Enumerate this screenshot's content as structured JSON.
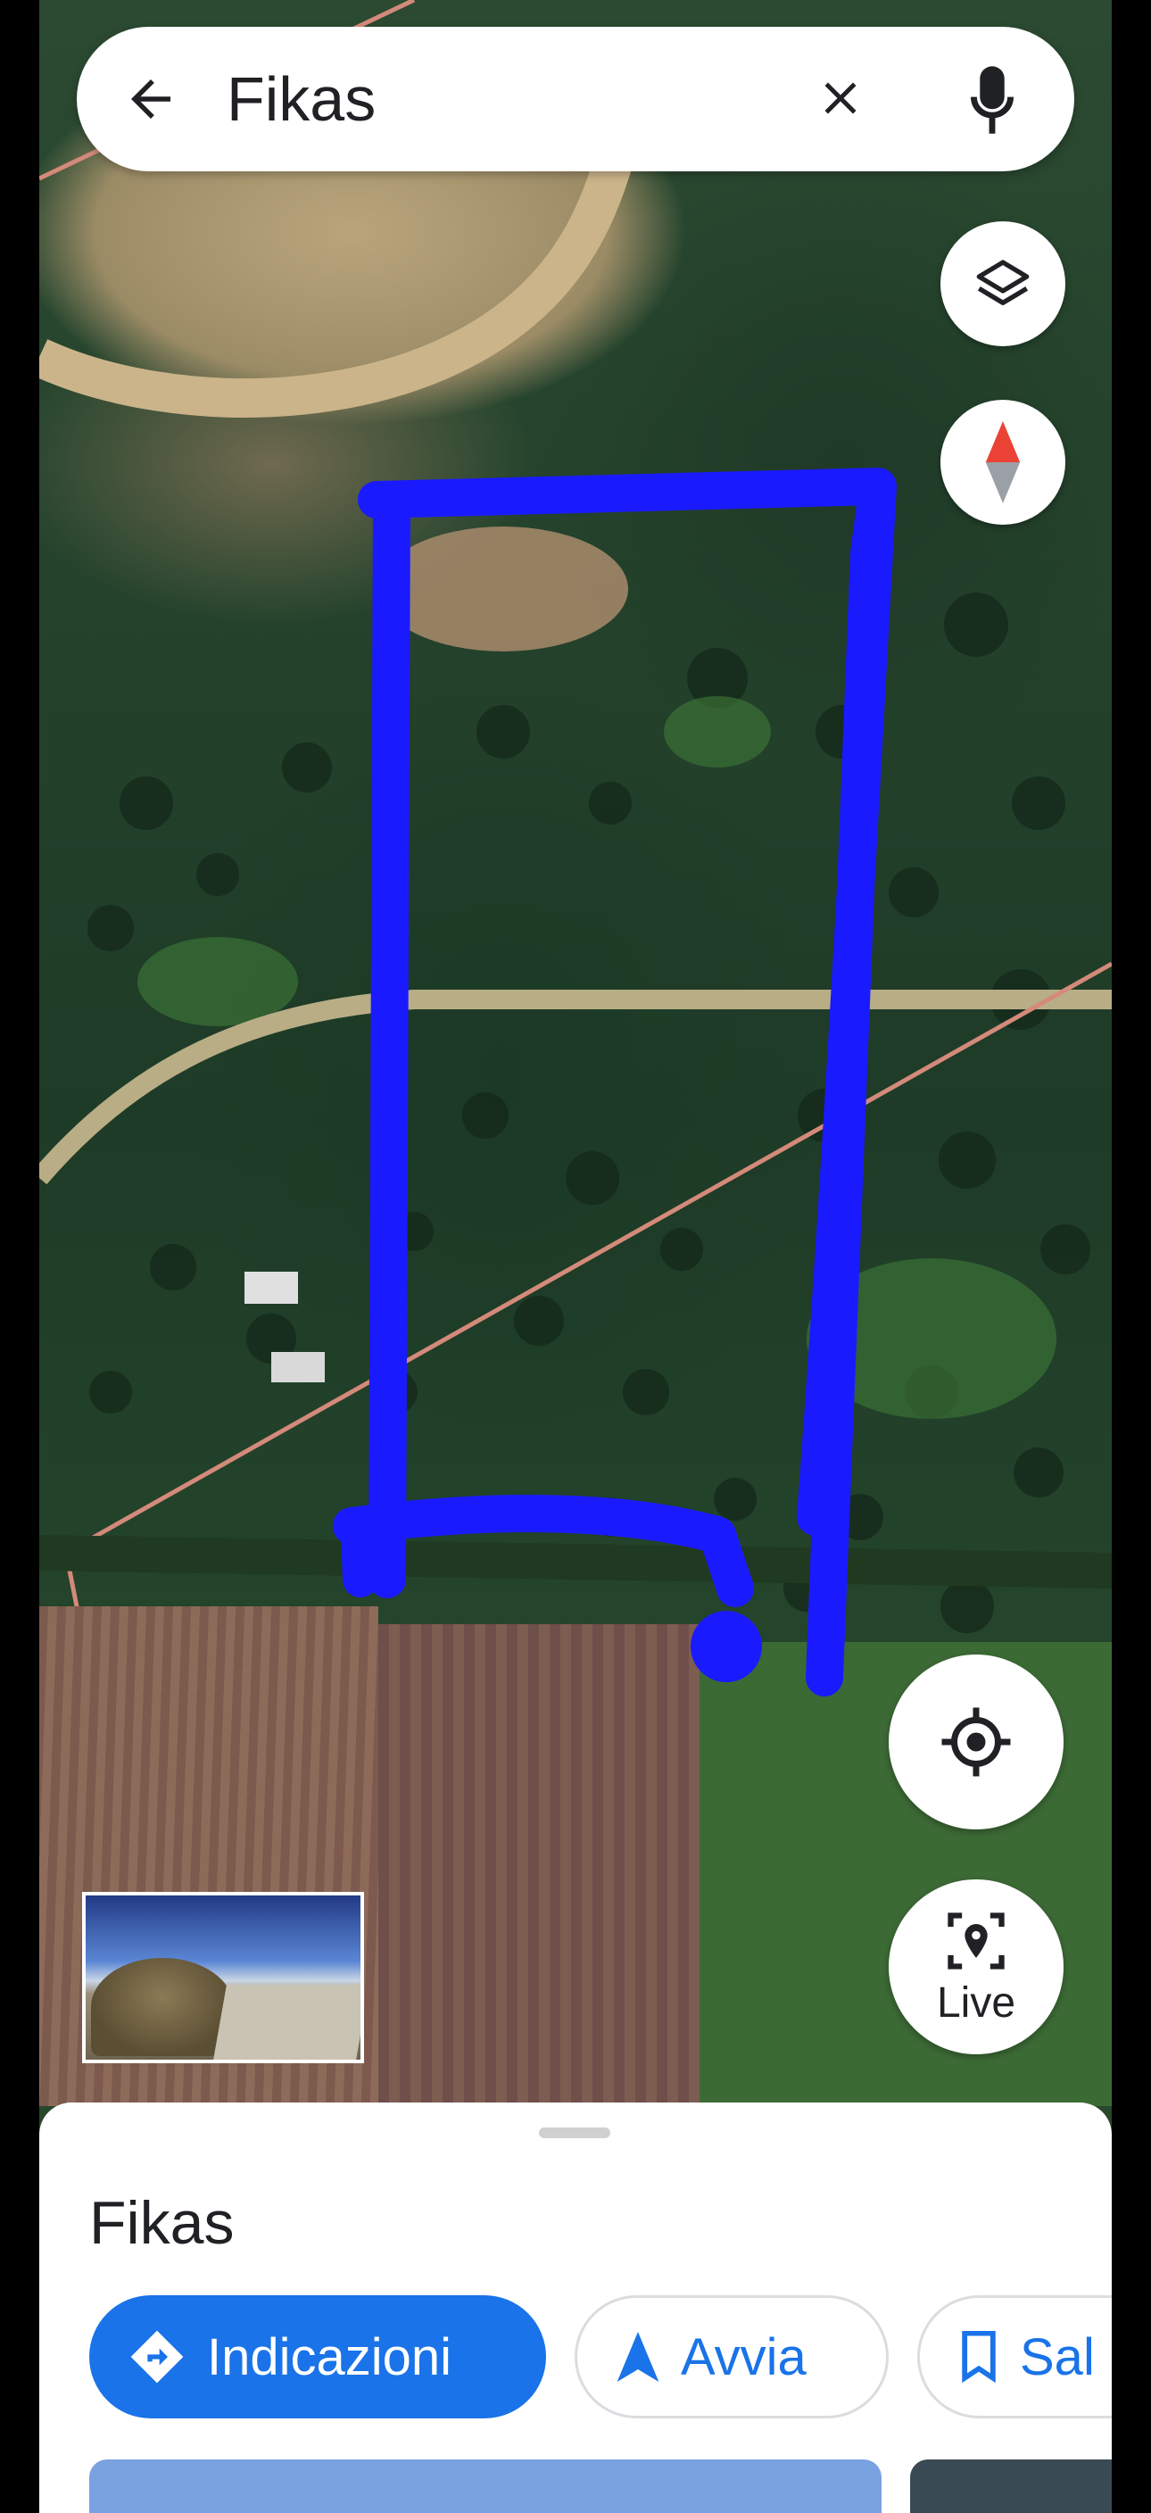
{
  "search": {
    "query": "Fikas",
    "back_icon": "arrow-back-icon",
    "clear_icon": "close-icon",
    "mic_icon": "mic-icon"
  },
  "map": {
    "type": "satellite",
    "drawn_outline_color": "#1a1aff",
    "layers_icon": "layers-icon",
    "compass_icon": "compass-icon",
    "locate_icon": "my-location-icon",
    "live_label": "Live",
    "live_icon": "live-view-icon"
  },
  "place": {
    "title": "Fikas",
    "actions": [
      {
        "label": "Indicazioni",
        "icon": "directions-icon"
      },
      {
        "label": "Avvia",
        "icon": "navigation-arrow-icon"
      },
      {
        "label": "Sal",
        "icon": "bookmark-icon"
      }
    ]
  },
  "colors": {
    "accent": "#1a73e8",
    "text": "#202124"
  }
}
